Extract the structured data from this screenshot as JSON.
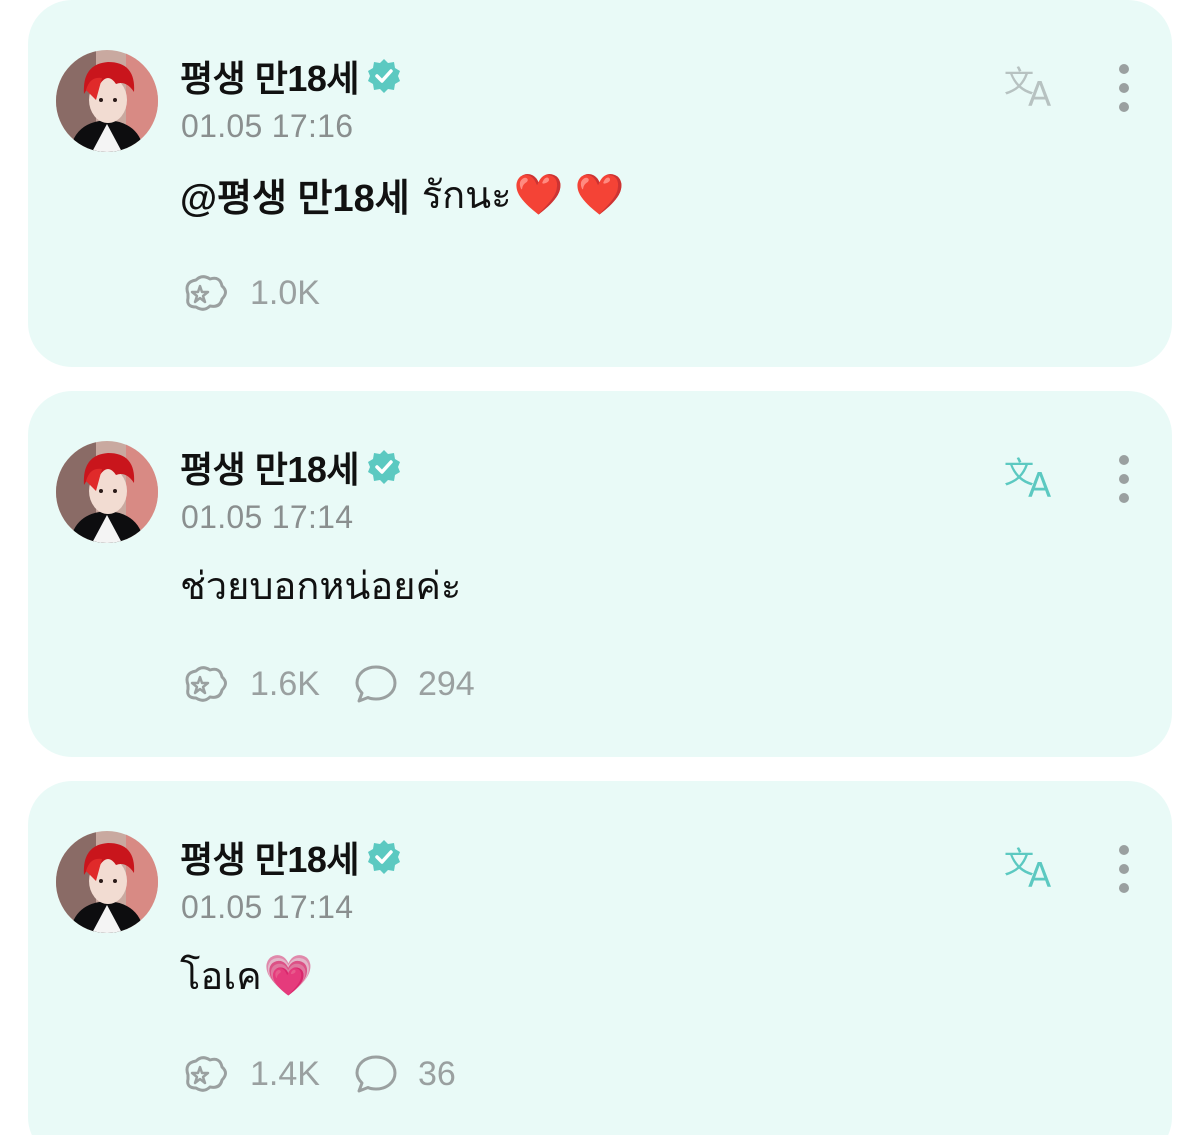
{
  "colors": {
    "card_bg": "#e9faf7",
    "accent_teal": "#5cc9c1",
    "muted_gray": "#9aa0a0",
    "text_dark": "#111111"
  },
  "posts": [
    {
      "author": "평생 만18세",
      "verified": true,
      "timestamp": "01.05 17:16",
      "mention": "@평생 만18세",
      "text": "รักนะ",
      "emoji": "❤️ ❤️",
      "likes": "1.0K",
      "comments": null,
      "translate_icon": "translate-icon",
      "more_icon": "more-vertical-icon"
    },
    {
      "author": "평생 만18세",
      "verified": true,
      "timestamp": "01.05 17:14",
      "mention": "",
      "text": "ช่วยบอกหน่อยค่ะ",
      "emoji": "",
      "likes": "1.6K",
      "comments": "294",
      "translate_icon": "translate-icon",
      "more_icon": "more-vertical-icon"
    },
    {
      "author": "평생 만18세",
      "verified": true,
      "timestamp": "01.05 17:14",
      "mention": "",
      "text": "โอเค",
      "emoji": "💗",
      "likes": "1.4K",
      "comments": "36",
      "translate_icon": "translate-icon",
      "more_icon": "more-vertical-icon"
    }
  ]
}
